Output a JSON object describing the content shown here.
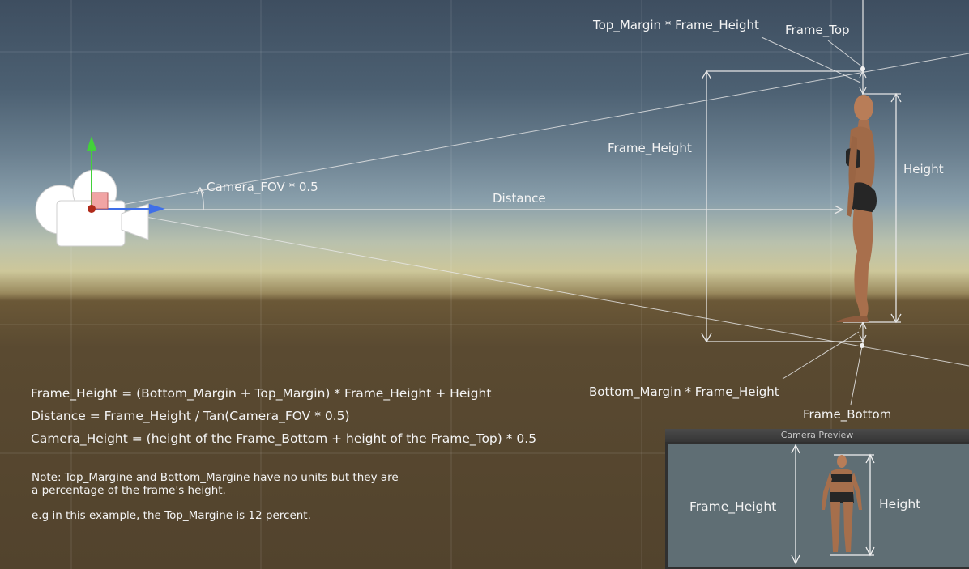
{
  "labels": {
    "top_margin": "Top_Margin * Frame_Height",
    "frame_top": "Frame_Top",
    "frame_height": "Frame_Height",
    "height": "Height",
    "camera_fov": "Camera_FOV * 0.5",
    "distance": "Distance",
    "bottom_margin": "Bottom_Margin * Frame_Height",
    "frame_bottom": "Frame_Bottom"
  },
  "formulas": [
    "Frame_Height = (Bottom_Margin + Top_Margin) * Frame_Height  + Height",
    "Distance = Frame_Height / Tan(Camera_FOV * 0.5)",
    "Camera_Height = (height of the Frame_Bottom + height of the Frame_Top) * 0.5"
  ],
  "note": {
    "text": "Note: Top_Margine and Bottom_Margine have no units but they are\na percentage of the frame's height.",
    "example": "e.g in this example, the Top_Margine is 12 percent."
  },
  "preview": {
    "title": "Camera Preview",
    "frame_height": "Frame_Height",
    "height": "Height"
  },
  "colors": {
    "sky_top": "#3e4e60",
    "horizon": "#cdc79a",
    "ground": "#52432d",
    "axis_y": "#43d13a",
    "axis_z": "#3f6fe8",
    "axis_x": "#b02a1a"
  },
  "icons": [
    "camera-gizmo-icon",
    "character-figure"
  ]
}
